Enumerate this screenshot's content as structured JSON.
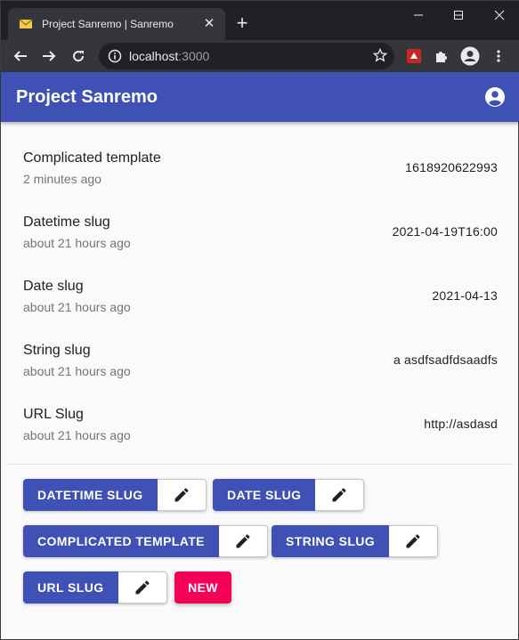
{
  "browser": {
    "tab_title": "Project Sanremo | Sanremo",
    "url_host": "localhost",
    "url_port": ":3000"
  },
  "app": {
    "title": "Project Sanremo"
  },
  "items": [
    {
      "title": "Complicated template",
      "time": "2 minutes ago",
      "value": "1618920622993"
    },
    {
      "title": "Datetime slug",
      "time": "about 21 hours ago",
      "value": "2021-04-19T16:00"
    },
    {
      "title": "Date slug",
      "time": "about 21 hours ago",
      "value": "2021-04-13"
    },
    {
      "title": "String slug",
      "time": "about 21 hours ago",
      "value": "a asdfsadfdsaadfs"
    },
    {
      "title": "URL Slug",
      "time": "about 21 hours ago",
      "value": "http://asdasd"
    }
  ],
  "buttons": {
    "datetime": "DATETIME SLUG",
    "date": "DATE SLUG",
    "complicated": "COMPLICATED TEMPLATE",
    "string": "STRING SLUG",
    "url": "URL SLUG",
    "new": "NEW"
  },
  "colors": {
    "primary": "#3f51b5",
    "accent": "#f50057"
  }
}
